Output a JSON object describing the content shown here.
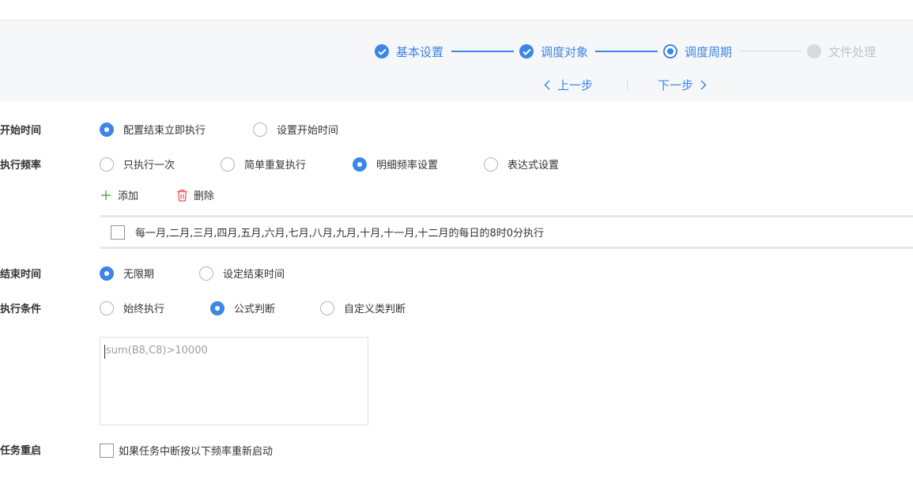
{
  "steps": [
    {
      "label": "基本设置",
      "state": "done"
    },
    {
      "label": "调度对象",
      "state": "done"
    },
    {
      "label": "调度周期",
      "state": "current"
    },
    {
      "label": "文件处理",
      "state": "todo"
    }
  ],
  "nav": {
    "prev_label": "上一步",
    "next_label": "下一步"
  },
  "start_time": {
    "label": "开始时间",
    "options": [
      "配置结束立即执行",
      "设置开始时间"
    ],
    "selected": 0
  },
  "frequency": {
    "label": "执行频率",
    "options": [
      "只执行一次",
      "简单重复执行",
      "明细频率设置",
      "表达式设置"
    ],
    "selected": 2,
    "add_label": "添加",
    "delete_label": "删除",
    "items": [
      "每一月,二月,三月,四月,五月,六月,七月,八月,九月,十月,十一月,十二月的每日的8时0分执行"
    ]
  },
  "end_time": {
    "label": "结束时间",
    "options": [
      "无限期",
      "设定结束时间"
    ],
    "selected": 0
  },
  "condition": {
    "label": "执行条件",
    "options": [
      "始终执行",
      "公式判断",
      "自定义类判断"
    ],
    "selected": 1,
    "formula_value": "sum(B8,C8)>10000"
  },
  "restart": {
    "label": "任务重启",
    "checkbox_label": "如果任务中断按以下频率重新启动"
  },
  "colors": {
    "accent": "#3b86e7",
    "add_icon": "#4caf50",
    "delete_icon": "#e55353"
  }
}
